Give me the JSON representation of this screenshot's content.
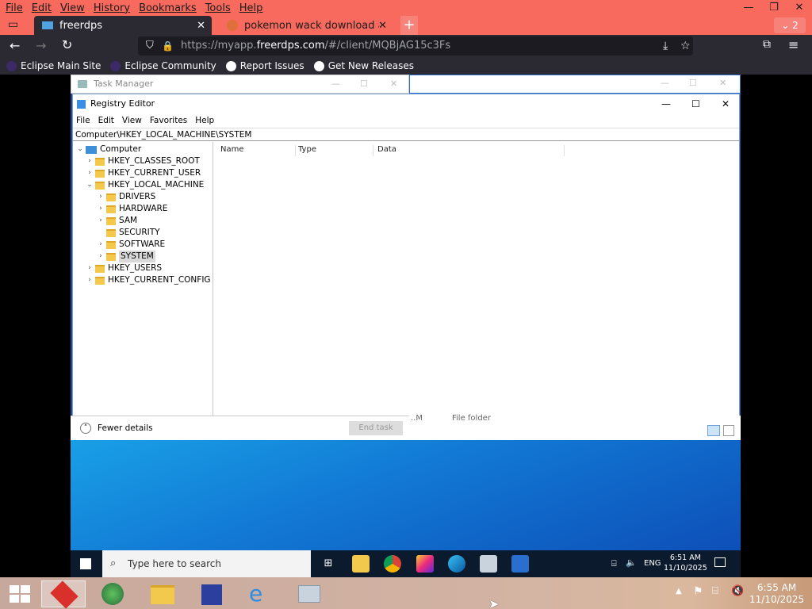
{
  "firefox": {
    "menu": [
      "File",
      "Edit",
      "View",
      "History",
      "Bookmarks",
      "Tools",
      "Help"
    ],
    "tabs": [
      {
        "title": "freerdps"
      },
      {
        "title": "pokemon wack download at Du"
      }
    ],
    "tab_count": "2",
    "url_prefix": "https://myapp.",
    "url_domain": "freerdps.com",
    "url_suffix": "/#/client/MQBjAG15c3Fs",
    "bookmarks": [
      "Eclipse Main Site",
      "Eclipse Community",
      "Report Issues",
      "Get New Releases"
    ]
  },
  "task_manager": {
    "title": "Task Manager",
    "fewer_details": "Fewer details",
    "end_task": "End task",
    "partial_text": "File folder",
    "partial_m": "..M"
  },
  "regedit": {
    "title": "Registry Editor",
    "menu": [
      "File",
      "Edit",
      "View",
      "Favorites",
      "Help"
    ],
    "address": "Computer\\HKEY_LOCAL_MACHINE\\SYSTEM",
    "tree": {
      "root": "Computer",
      "hkcr": "HKEY_CLASSES_ROOT",
      "hkcu": "HKEY_CURRENT_USER",
      "hklm": "HKEY_LOCAL_MACHINE",
      "drivers": "DRIVERS",
      "hardware": "HARDWARE",
      "sam": "SAM",
      "security": "SECURITY",
      "software": "SOFTWARE",
      "system": "SYSTEM",
      "hku": "HKEY_USERS",
      "hkcc": "HKEY_CURRENT_CONFIG"
    },
    "columns": [
      "Name",
      "Type",
      "Data"
    ]
  },
  "remote_taskbar": {
    "search_placeholder": "Type here to search",
    "lang": "ENG",
    "time": "6:51 AM",
    "date": "11/10/2025"
  },
  "host_taskbar": {
    "time": "6:55 AM",
    "date": "11/10/2025"
  },
  "colors": {
    "firefox_accent": "#f96a5e",
    "firefox_dark": "#2b2a33"
  }
}
